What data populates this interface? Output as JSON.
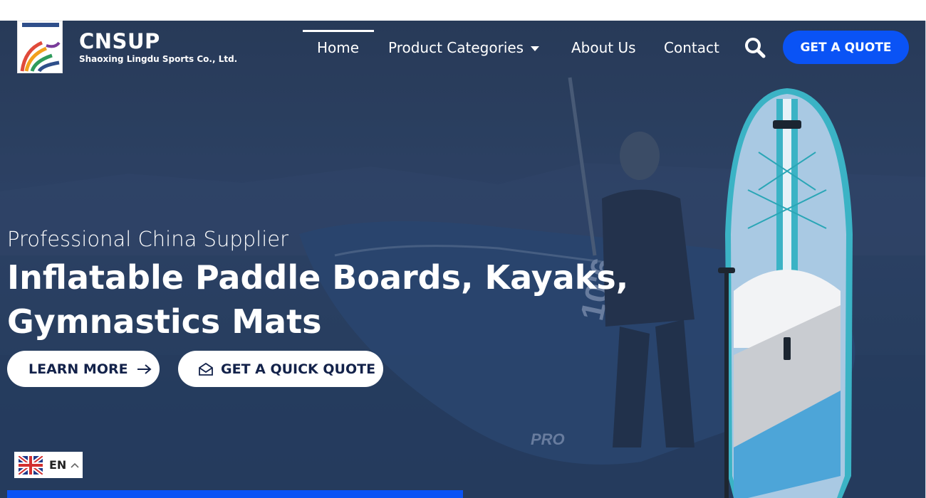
{
  "brand": {
    "name": "CNSUP",
    "subtitle": "Shaoxing Lingdu Sports Co., Ltd."
  },
  "nav": {
    "items": [
      {
        "label": "Home",
        "active": true
      },
      {
        "label": "Product Categories",
        "has_dropdown": true
      },
      {
        "label": "About Us"
      },
      {
        "label": "Contact"
      }
    ],
    "search_icon": "search-icon",
    "quote_button": "GET A QUOTE"
  },
  "hero": {
    "subtitle": "Professional China Supplier",
    "headline": "Inflatable Paddle Boards, Kayaks, Gymnastics Mats",
    "learn_more": "LEARN MORE",
    "quick_quote": "GET A QUICK QUOTE",
    "board_marking": "10'6",
    "brand_marking": "PRO"
  },
  "language": {
    "code": "EN",
    "flag_icon": "uk-flag-icon"
  },
  "colors": {
    "accent": "#0a53f5",
    "button_text": "#13224a",
    "overlay": "#2c3e58"
  }
}
